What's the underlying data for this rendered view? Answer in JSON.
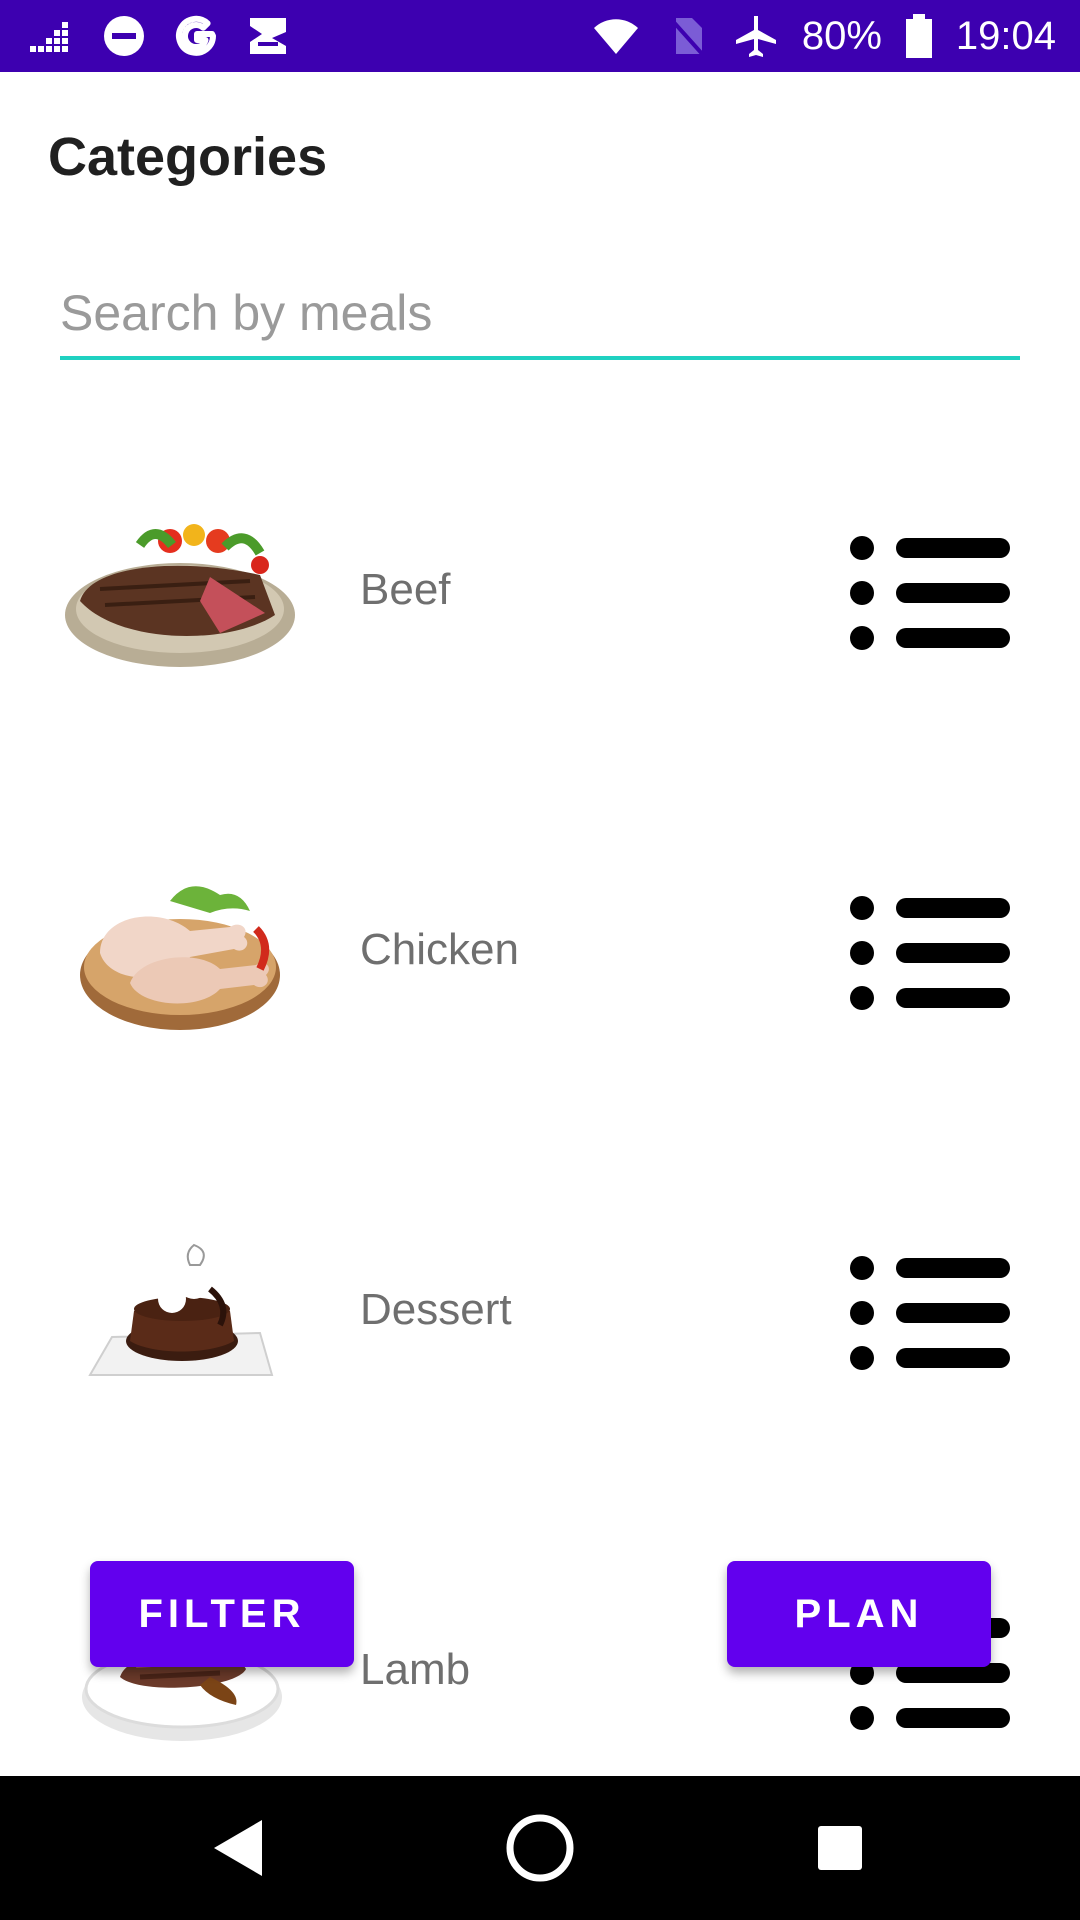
{
  "status_bar": {
    "battery_text": "80%",
    "time": "19:04",
    "icons_left": [
      "signal-bars-icon",
      "do-not-disturb-icon",
      "google-icon",
      "image-icon"
    ],
    "icons_right": [
      "wifi-icon",
      "no-sim-icon",
      "airplane-mode-icon",
      "battery-icon"
    ],
    "background_color": "#3d00b0"
  },
  "header": {
    "title": "Categories"
  },
  "search": {
    "placeholder": "Search by meals",
    "value": "",
    "underline_color": "#1fd1c1"
  },
  "categories": [
    {
      "label": "Beef",
      "image": "beef-steak-image",
      "action_icon": "list-icon"
    },
    {
      "label": "Chicken",
      "image": "chicken-legs-image",
      "action_icon": "list-icon"
    },
    {
      "label": "Dessert",
      "image": "chocolate-cake-image",
      "action_icon": "list-icon"
    },
    {
      "label": "Lamb",
      "image": "lamb-plate-image",
      "action_icon": "list-icon"
    }
  ],
  "buttons": {
    "filter_label": "FILTER",
    "plan_label": "PLAN",
    "color": "#6200ee"
  },
  "nav_bar": {
    "icons": [
      "back-icon",
      "home-icon",
      "recent-apps-icon"
    ]
  }
}
